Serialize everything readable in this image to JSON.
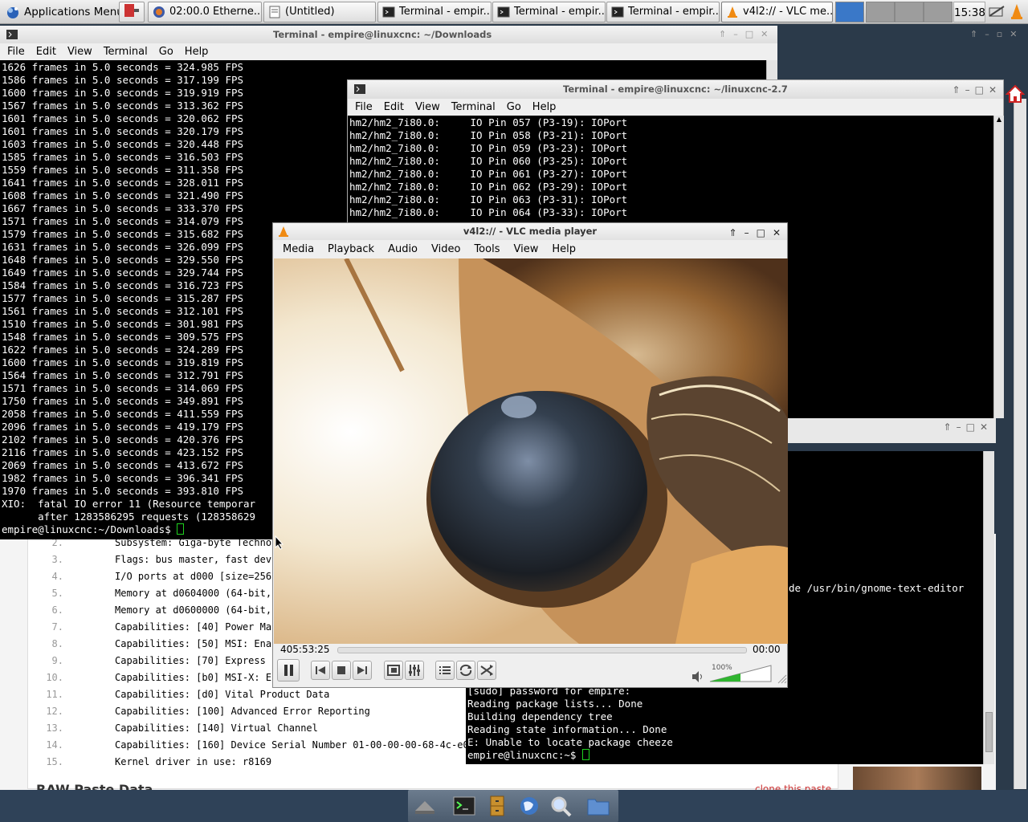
{
  "taskbar": {
    "app_menu": "Applications Menu",
    "tasks": [
      {
        "label": "02:00.0 Etherne..."
      },
      {
        "label": "(Untitled)"
      },
      {
        "label": "Terminal - empir..."
      },
      {
        "label": "Terminal - empir..."
      },
      {
        "label": "Terminal - empir..."
      },
      {
        "label": "v4l2:// - VLC me..."
      }
    ],
    "clock": "15:38"
  },
  "term_downloads": {
    "title": "Terminal - empire@linuxcnc: ~/Downloads",
    "menu": [
      "File",
      "Edit",
      "View",
      "Terminal",
      "Go",
      "Help"
    ],
    "lines": [
      "1626 frames in 5.0 seconds = 324.985 FPS",
      "1586 frames in 5.0 seconds = 317.199 FPS",
      "1600 frames in 5.0 seconds = 319.919 FPS",
      "1567 frames in 5.0 seconds = 313.362 FPS",
      "1601 frames in 5.0 seconds = 320.062 FPS",
      "1601 frames in 5.0 seconds = 320.179 FPS",
      "1603 frames in 5.0 seconds = 320.448 FPS",
      "1585 frames in 5.0 seconds = 316.503 FPS",
      "1559 frames in 5.0 seconds = 311.358 FPS",
      "1641 frames in 5.0 seconds = 328.011 FPS",
      "1608 frames in 5.0 seconds = 321.490 FPS",
      "1667 frames in 5.0 seconds = 333.370 FPS",
      "1571 frames in 5.0 seconds = 314.079 FPS",
      "1579 frames in 5.0 seconds = 315.682 FPS",
      "1631 frames in 5.0 seconds = 326.099 FPS",
      "1648 frames in 5.0 seconds = 329.550 FPS",
      "1649 frames in 5.0 seconds = 329.744 FPS",
      "1584 frames in 5.0 seconds = 316.723 FPS",
      "1577 frames in 5.0 seconds = 315.287 FPS",
      "1561 frames in 5.0 seconds = 312.101 FPS",
      "1510 frames in 5.0 seconds = 301.981 FPS",
      "1548 frames in 5.0 seconds = 309.575 FPS",
      "1622 frames in 5.0 seconds = 324.289 FPS",
      "1600 frames in 5.0 seconds = 319.819 FPS",
      "1564 frames in 5.0 seconds = 312.791 FPS",
      "1571 frames in 5.0 seconds = 314.069 FPS",
      "1750 frames in 5.0 seconds = 349.891 FPS",
      "2058 frames in 5.0 seconds = 411.559 FPS",
      "2096 frames in 5.0 seconds = 419.179 FPS",
      "2102 frames in 5.0 seconds = 420.376 FPS",
      "2116 frames in 5.0 seconds = 423.152 FPS",
      "2069 frames in 5.0 seconds = 413.672 FPS",
      "1982 frames in 5.0 seconds = 396.341 FPS",
      "1970 frames in 5.0 seconds = 393.810 FPS",
      "XIO:  fatal IO error 11 (Resource temporar",
      "      after 1283586295 requests (128358629"
    ],
    "prompt": "empire@linuxcnc:~/Downloads$ "
  },
  "term_linuxcnc": {
    "title": "Terminal - empire@linuxcnc: ~/linuxcnc-2.7",
    "menu": [
      "File",
      "Edit",
      "View",
      "Terminal",
      "Go",
      "Help"
    ],
    "lines": [
      "hm2/hm2_7i80.0:     IO Pin 057 (P3-19): IOPort",
      "hm2/hm2_7i80.0:     IO Pin 058 (P3-21): IOPort",
      "hm2/hm2_7i80.0:     IO Pin 059 (P3-23): IOPort",
      "hm2/hm2_7i80.0:     IO Pin 060 (P3-25): IOPort",
      "hm2/hm2_7i80.0:     IO Pin 061 (P3-27): IOPort",
      "hm2/hm2_7i80.0:     IO Pin 062 (P3-29): IOPort",
      "hm2/hm2_7i80.0:     IO Pin 063 (P3-31): IOPort",
      "hm2/hm2_7i80.0:     IO Pin 064 (P3-33): IOPort"
    ]
  },
  "term_third": {
    "side_text": "de /usr/bin/gnome-text-editor",
    "lines": [
      "[sudo] password for empire:",
      "Reading package lists... Done",
      "Building dependency tree",
      "Reading state information... Done",
      "E: Unable to locate package cheeze"
    ],
    "prompt": "empire@linuxcnc:~$ "
  },
  "paste_page": {
    "rows": [
      {
        "n": "2.",
        "text": "Subsystem: Giga-byte Techno"
      },
      {
        "n": "3.",
        "text": "Flags: bus master, fast dev"
      },
      {
        "n": "4.",
        "text": "I/O ports at d000 [size=256"
      },
      {
        "n": "5.",
        "text": "Memory at d0604000 (64-bit,"
      },
      {
        "n": "6.",
        "text": "Memory at d0600000 (64-bit,"
      },
      {
        "n": "7.",
        "text": "Capabilities: [40] Power Ma"
      },
      {
        "n": "8.",
        "text": "Capabilities: [50] MSI: Ena"
      },
      {
        "n": "9.",
        "text": "Capabilities: [70] Express "
      },
      {
        "n": "10.",
        "text": "Capabilities: [b0] MSI-X: E"
      },
      {
        "n": "11.",
        "text": "Capabilities: [d0] Vital Product Data"
      },
      {
        "n": "12.",
        "text": "Capabilities: [100] Advanced Error Reporting"
      },
      {
        "n": "13.",
        "text": "Capabilities: [140] Virtual Channel"
      },
      {
        "n": "14.",
        "text": "Capabilities: [160] Device Serial Number 01-00-00-00-68-4c-e0-"
      },
      {
        "n": "15.",
        "text": "Kernel driver in use: r8169"
      }
    ],
    "footer_left": "RAW Paste Data",
    "footer_right": "clone this paste"
  },
  "vlc": {
    "title": "v4l2:// - VLC media player",
    "menu": [
      "Media",
      "Playback",
      "Audio",
      "Video",
      "Tools",
      "View",
      "Help"
    ],
    "elapsed": "405:53:25",
    "total": "00:00",
    "volume_label": "100%",
    "volume": 0.5
  },
  "colors": {
    "terminal_bg": "#000000",
    "terminal_fg": "#ffffff",
    "cursor": "#1fd11f",
    "volume_fill": "#2fb52f"
  }
}
